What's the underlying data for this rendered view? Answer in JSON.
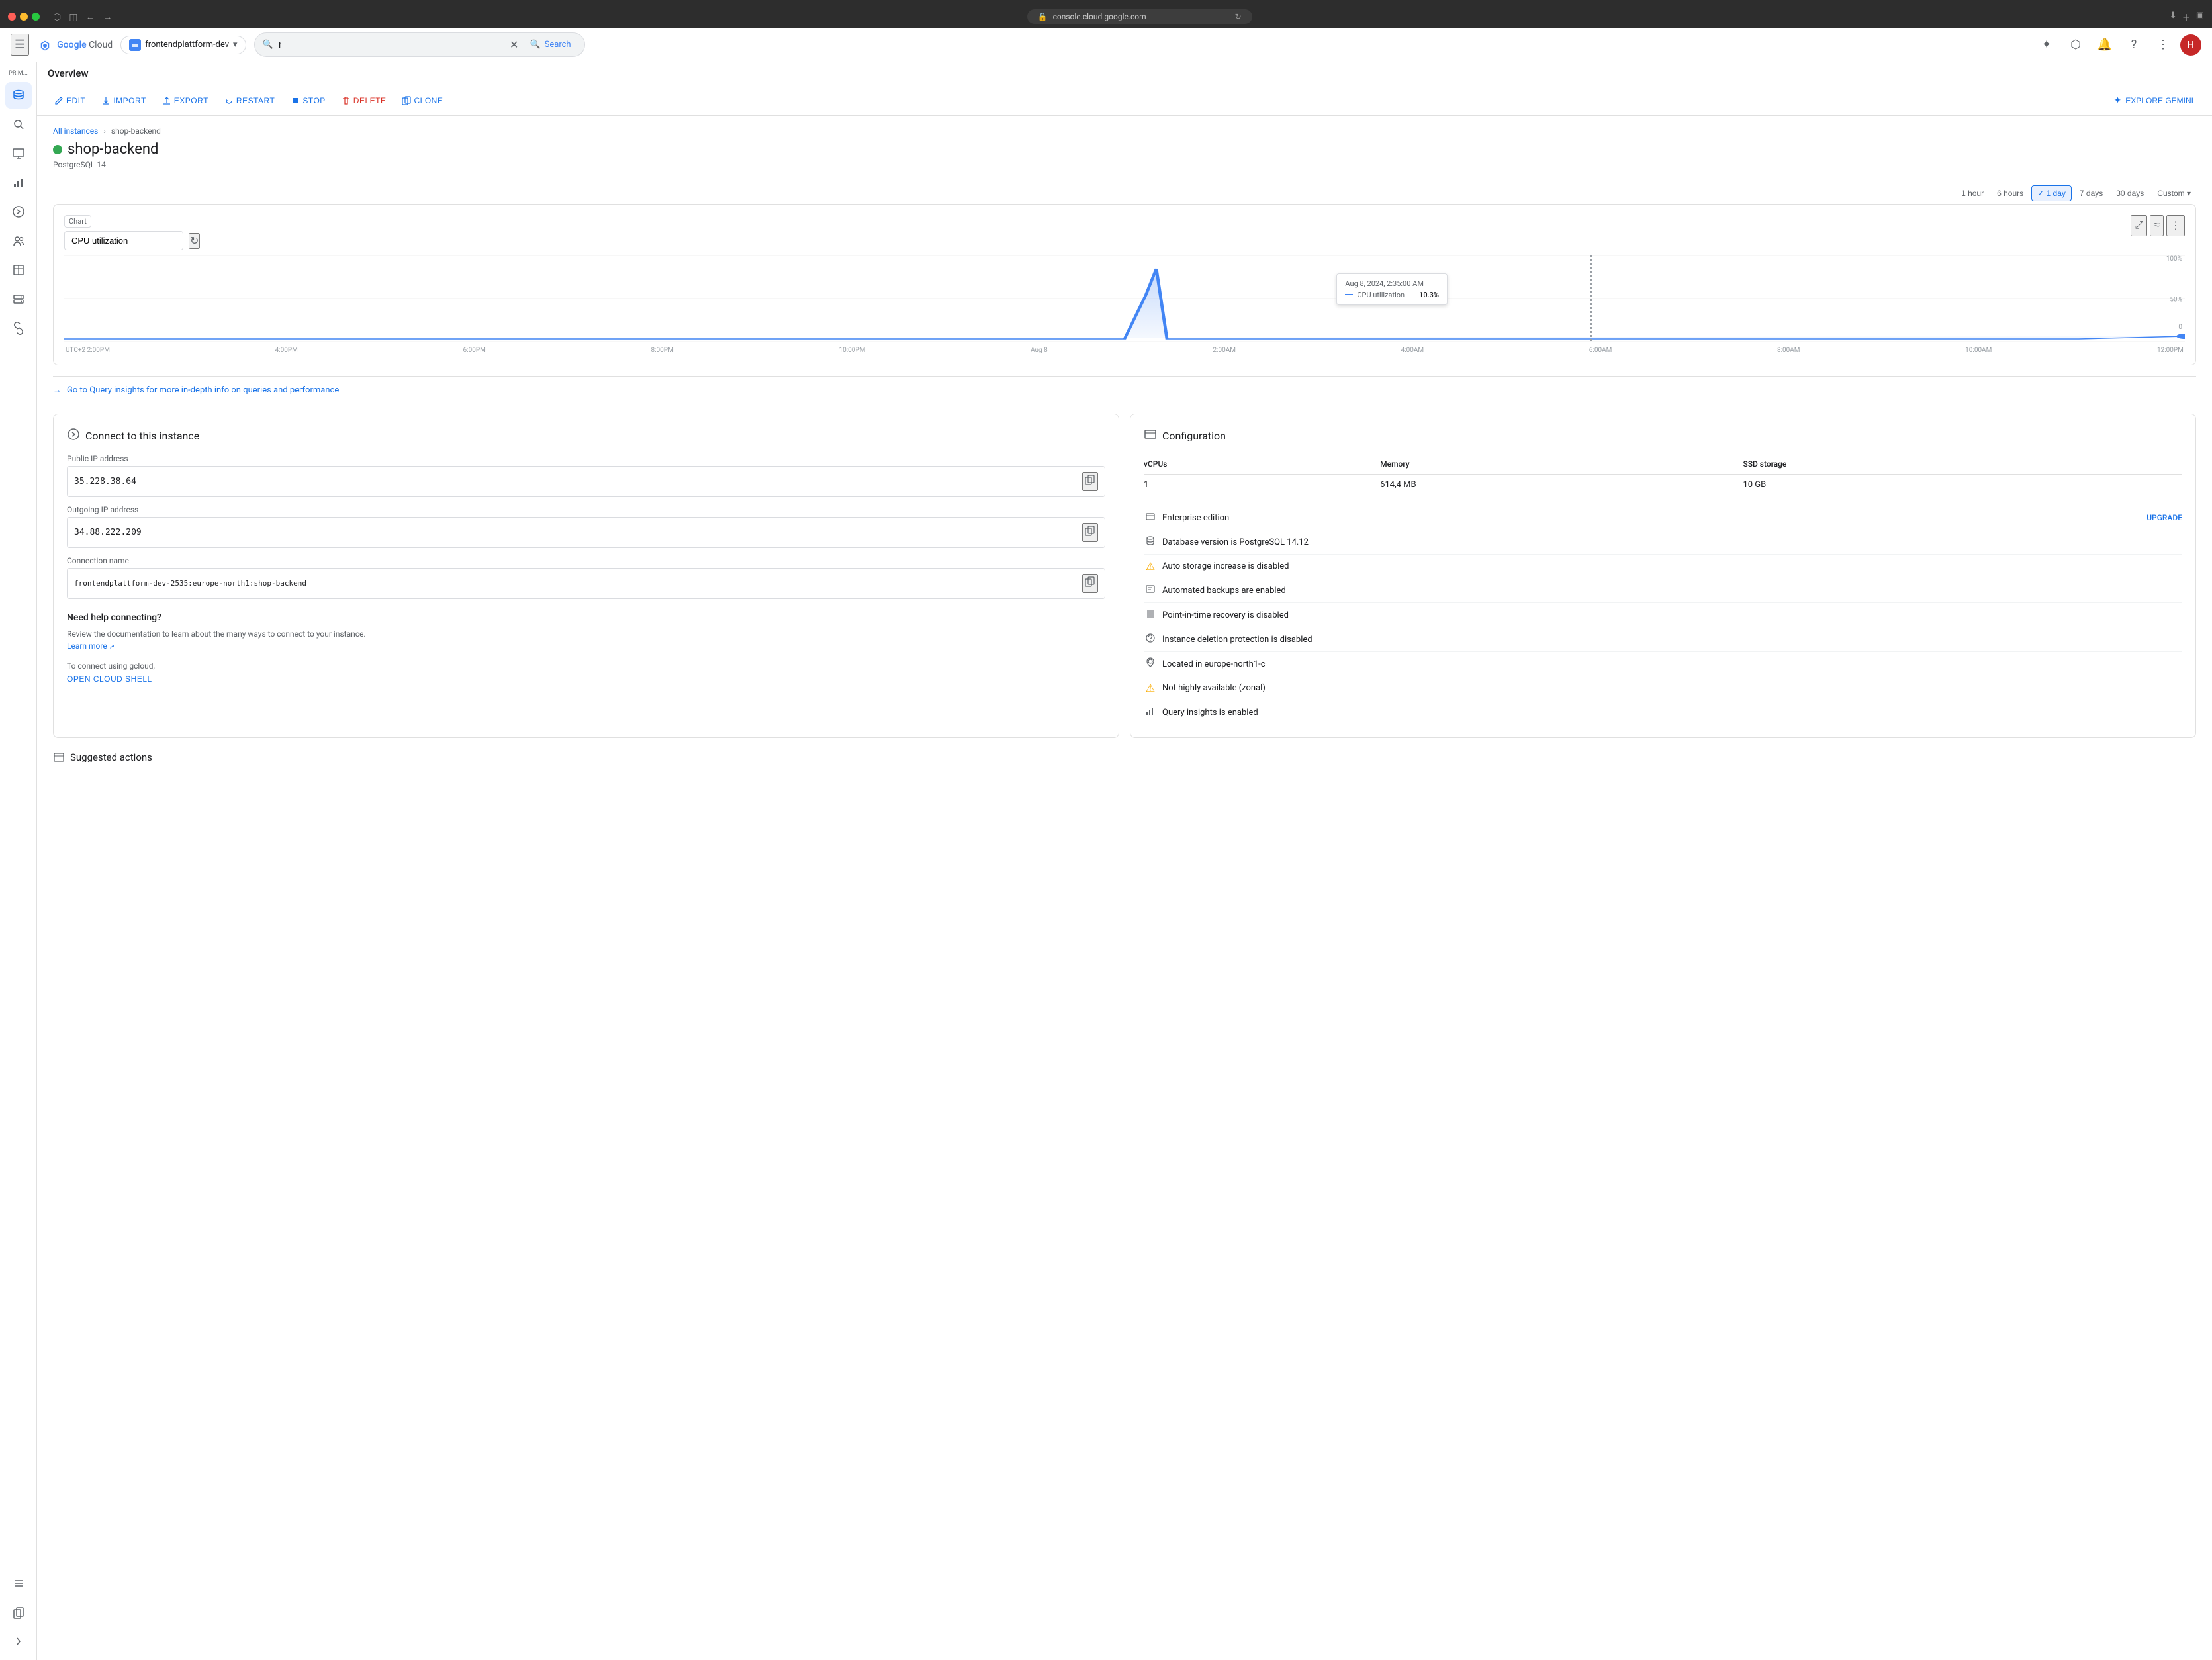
{
  "browser": {
    "url": "console.cloud.google.com",
    "search_placeholder": "f"
  },
  "topbar": {
    "logo": "Google Cloud",
    "logo_google": "Google",
    "logo_cloud": "Cloud",
    "project_name": "frontendplattform-dev",
    "search_value": "f",
    "search_button": "Search",
    "avatar_letter": "H"
  },
  "breadcrumb": {
    "parent": "All instances",
    "current": "shop-backend"
  },
  "instance": {
    "name": "shop-backend",
    "type": "PostgreSQL 14",
    "status": "running"
  },
  "actions": {
    "edit": "EDIT",
    "import": "IMPORT",
    "export": "EXPORT",
    "restart": "RESTART",
    "stop": "STOP",
    "delete": "DELETE",
    "clone": "CLONE",
    "explore_gemini": "EXPLORE GEMINI"
  },
  "time_ranges": [
    {
      "label": "1 hour",
      "active": false
    },
    {
      "label": "6 hours",
      "active": false
    },
    {
      "label": "1 day",
      "active": true
    },
    {
      "label": "7 days",
      "active": false
    },
    {
      "label": "30 days",
      "active": false
    },
    {
      "label": "Custom",
      "active": false
    }
  ],
  "chart": {
    "label": "Chart",
    "select_value": "CPU utilization",
    "tooltip_time": "Aug 8, 2024, 2:35:00 AM",
    "tooltip_metric": "CPU utilization",
    "tooltip_value": "10.3%",
    "y_axis_100": "100%",
    "y_axis_50": "50%",
    "y_axis_0": "0",
    "x_labels": [
      "UTC+2 2:00PM",
      "4:00PM",
      "6:00PM",
      "8:00PM",
      "10:00PM",
      "Aug 8",
      "2:00AM",
      "4:00AM",
      "6:00AM",
      "8:00AM",
      "10:00AM",
      "12:00PM"
    ]
  },
  "query_insights": {
    "text": "Go to Query insights for more in-depth info on queries and performance"
  },
  "connect_card": {
    "title": "Connect to this instance",
    "public_ip_label": "Public IP address",
    "public_ip_value": "35.228.38.64",
    "outgoing_ip_label": "Outgoing IP address",
    "outgoing_ip_value": "34.88.222.209",
    "connection_name_label": "Connection name",
    "connection_name_value": "frontendplattform-dev-2535:europe-north1:shop-backend",
    "need_help_title": "Need help connecting?",
    "need_help_desc": "Review the documentation to learn about the many ways to connect to your instance.",
    "learn_more": "Learn more",
    "connect_using_text": "To connect using gcloud,",
    "open_cloud_shell": "OPEN CLOUD SHELL"
  },
  "config_card": {
    "title": "Configuration",
    "vcpus_label": "vCPUs",
    "vcpus_value": "1",
    "memory_label": "Memory",
    "memory_value": "614,4 MB",
    "ssd_label": "SSD storage",
    "ssd_value": "10 GB",
    "rows": [
      {
        "icon": "enterprise",
        "text": "Enterprise edition",
        "link": "UPGRADE",
        "warn": false
      },
      {
        "icon": "database",
        "text": "Database version is PostgreSQL 14.12",
        "link": null,
        "warn": false
      },
      {
        "icon": "warning",
        "text": "Auto storage increase is disabled",
        "link": null,
        "warn": true
      },
      {
        "icon": "backup",
        "text": "Automated backups are enabled",
        "link": null,
        "warn": false
      },
      {
        "icon": "recovery",
        "text": "Point-in-time recovery is disabled",
        "link": null,
        "warn": false
      },
      {
        "icon": "shield",
        "text": "Instance deletion protection is disabled",
        "link": null,
        "warn": false
      },
      {
        "icon": "location",
        "text": "Located in europe-north1-c",
        "link": null,
        "warn": false
      },
      {
        "icon": "warning",
        "text": "Not highly available (zonal)",
        "link": null,
        "warn": true
      },
      {
        "icon": "query",
        "text": "Query insights is enabled",
        "link": null,
        "warn": false
      }
    ]
  },
  "suggested_actions": {
    "title": "Suggested actions"
  },
  "sidebar": {
    "top_label": "PRIM...",
    "icons": [
      "database",
      "search",
      "monitor",
      "chart",
      "arrow-right",
      "users",
      "table",
      "server",
      "link",
      "list"
    ]
  }
}
